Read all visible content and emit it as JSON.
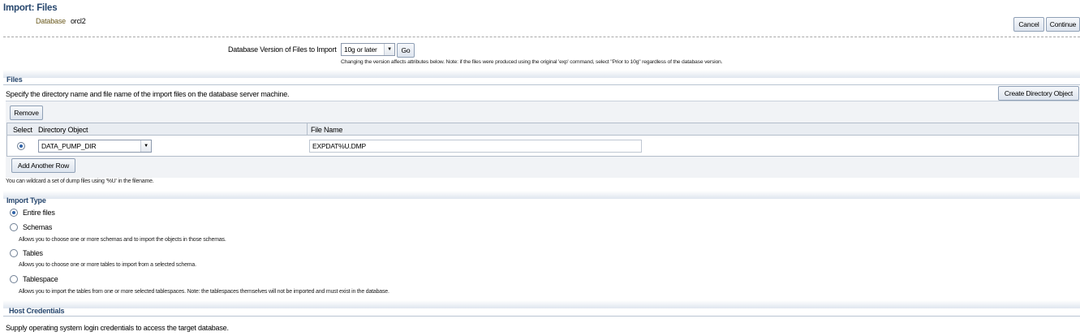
{
  "header": {
    "title": "Import: Files",
    "database_label": "Database",
    "database_value": "orcl2",
    "cancel_label": "Cancel",
    "continue_label": "Continue"
  },
  "version": {
    "label": "Database Version of Files to Import",
    "selected": "10g or later",
    "go_label": "Go",
    "note": "Changing the version affects attributes below. Note: if the files were produced using the original 'exp' command, select \"Prior to 10g\" regardless of the database version."
  },
  "files": {
    "title": "Files",
    "description": "Specify the directory name and file name of the import files on the database server machine.",
    "create_dir_label": "Create Directory Object",
    "remove_label": "Remove",
    "columns": {
      "select": "Select",
      "directory": "Directory Object",
      "filename": "File Name"
    },
    "row": {
      "directory": "DATA_PUMP_DIR",
      "filename": "EXPDAT%U.DMP",
      "selected": true
    },
    "add_row_label": "Add Another Row",
    "wildcard_note": "You can wildcard a set of dump files using '%U' in the filename."
  },
  "import_type": {
    "title": "Import Type",
    "options": [
      {
        "label": "Entire files",
        "desc": "",
        "selected": true
      },
      {
        "label": "Schemas",
        "desc": "Allows you to choose one or more schemas and to import the objects in those schemas.",
        "selected": false
      },
      {
        "label": "Tables",
        "desc": "Allows you to choose one or more tables to import from a selected schema.",
        "selected": false
      },
      {
        "label": "Tablespace",
        "desc": "Allows you to import the tables from one or more selected tablespaces. Note: the tablespaces themselves will not be imported and must exist in the database.",
        "selected": false
      }
    ]
  },
  "host_credentials": {
    "title": "Host Credentials",
    "description": "Supply operating system login credentials to access the target database."
  }
}
